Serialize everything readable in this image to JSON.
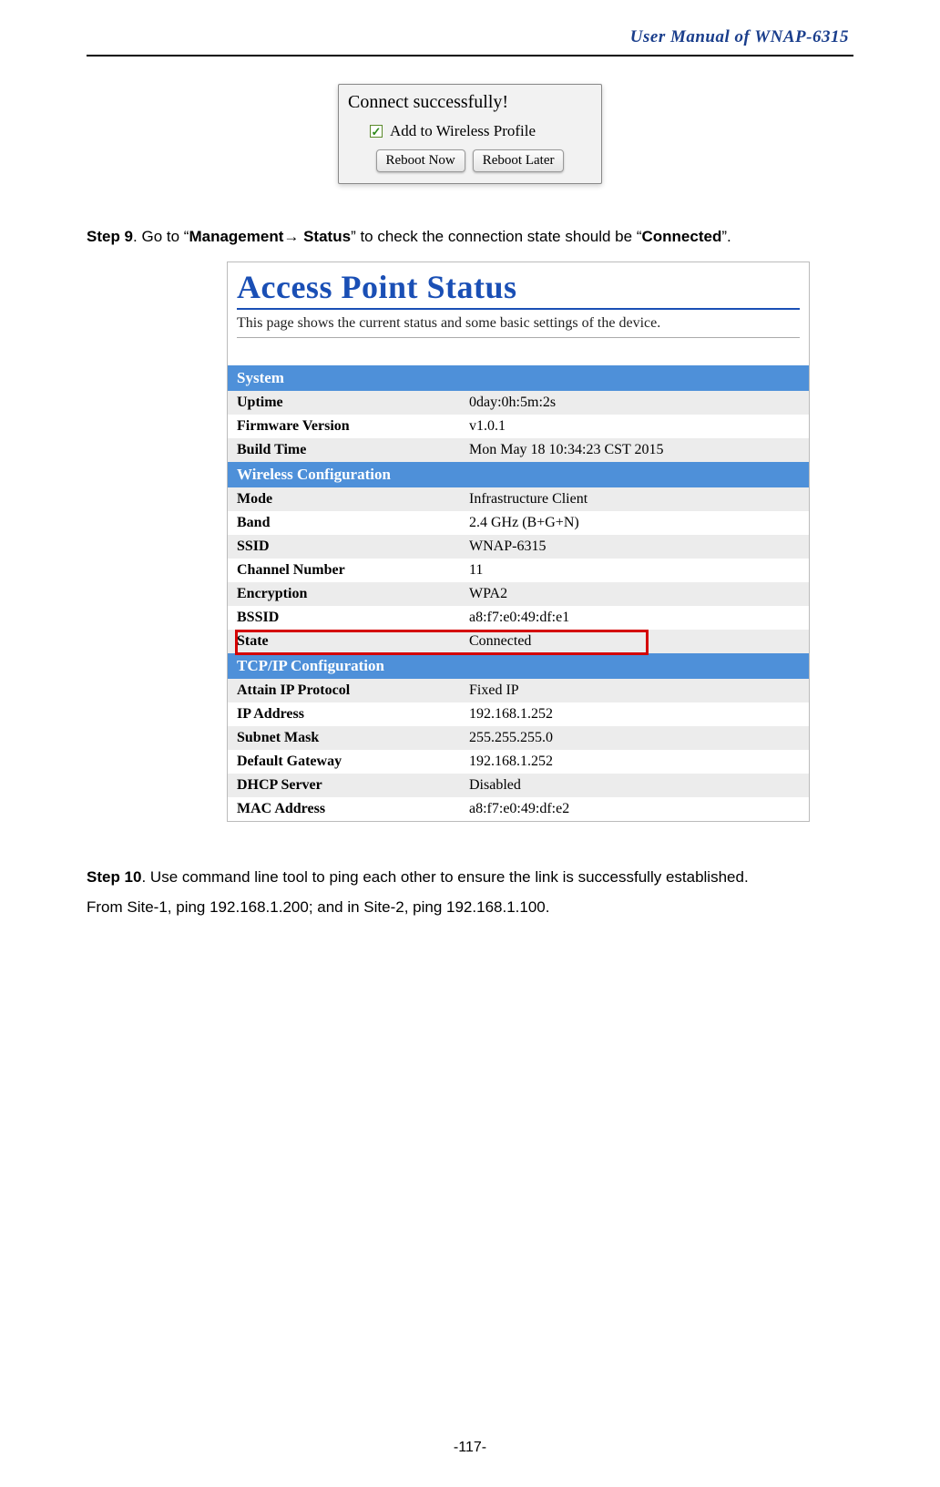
{
  "header": {
    "title": "User Manual of WNAP-6315"
  },
  "dialog": {
    "title": "Connect successfully!",
    "checkbox_label": "Add to Wireless Profile",
    "buttons": {
      "reboot_now": "Reboot Now",
      "reboot_later": "Reboot Later"
    }
  },
  "step9": {
    "prefix": "Step 9",
    "text_a": ". Go to “",
    "mgmt": "Management",
    "arrow": "→",
    "status": " Status",
    "text_b": "” to check the connection state should be “",
    "connected": "Connected",
    "text_c": "”."
  },
  "status_panel": {
    "title": "Access Point Status",
    "description": "This page shows the current status and some basic settings of the device.",
    "sections": {
      "system": "System",
      "wireless": "Wireless Configuration",
      "tcpip": "TCP/IP Configuration"
    },
    "rows": {
      "uptime": {
        "label": "Uptime",
        "value": "0day:0h:5m:2s"
      },
      "firmware": {
        "label": "Firmware Version",
        "value": "v1.0.1"
      },
      "build_time": {
        "label": "Build Time",
        "value": "Mon May 18 10:34:23 CST 2015"
      },
      "mode": {
        "label": "Mode",
        "value": "Infrastructure Client"
      },
      "band": {
        "label": "Band",
        "value": "2.4 GHz (B+G+N)"
      },
      "ssid": {
        "label": "SSID",
        "value": "WNAP-6315"
      },
      "channel": {
        "label": "Channel Number",
        "value": "11"
      },
      "encryption": {
        "label": "Encryption",
        "value": "WPA2"
      },
      "bssid": {
        "label": "BSSID",
        "value": "a8:f7:e0:49:df:e1"
      },
      "state": {
        "label": "State",
        "value": "Connected"
      },
      "attain_ip": {
        "label": "Attain IP Protocol",
        "value": "Fixed IP"
      },
      "ip_address": {
        "label": "IP Address",
        "value": "192.168.1.252"
      },
      "subnet_mask": {
        "label": "Subnet Mask",
        "value": "255.255.255.0"
      },
      "default_gateway": {
        "label": "Default Gateway",
        "value": "192.168.1.252"
      },
      "dhcp_server": {
        "label": "DHCP Server",
        "value": "Disabled"
      },
      "mac_address": {
        "label": "MAC Address",
        "value": "a8:f7:e0:49:df:e2"
      }
    }
  },
  "step10": {
    "prefix": "Step 10",
    "text": ". Use command line tool to ping each other to ensure the link is successfully established.",
    "line2": "From Site-1, ping 192.168.1.200; and in Site-2, ping 192.168.1.100."
  },
  "footer": {
    "page_number": "-117-"
  }
}
